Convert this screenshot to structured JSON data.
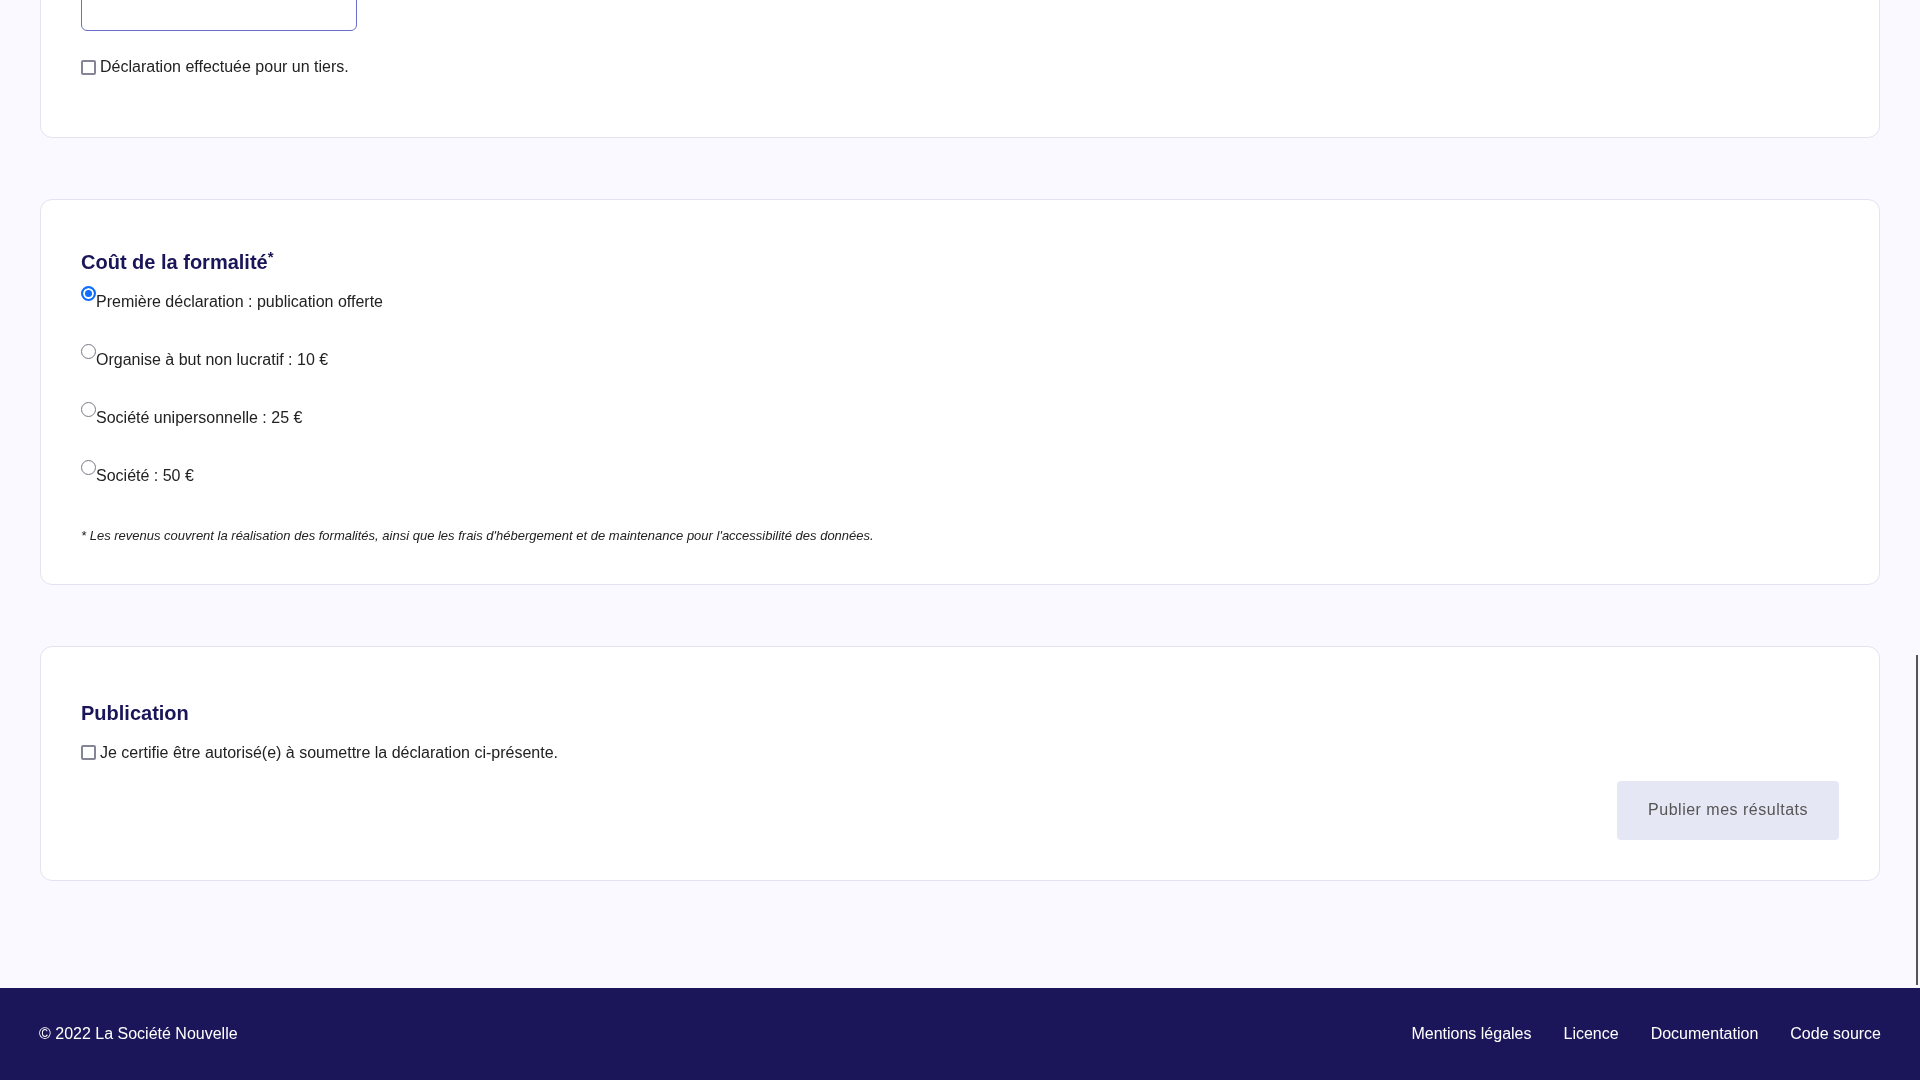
{
  "third_party": {
    "label": "Déclaration effectuée pour un tiers.",
    "checked": false
  },
  "cost": {
    "title": "Coût de la formalité",
    "title_mark": "*",
    "options": [
      {
        "label": "Première déclaration : publication offerte",
        "selected": true
      },
      {
        "label": "Organise à but non lucratif : 10 €",
        "selected": false
      },
      {
        "label": "Société unipersonnelle : 25 €",
        "selected": false
      },
      {
        "label": "Société : 50 €",
        "selected": false
      }
    ],
    "note": "* Les revenus couvrent la réalisation des formalités, ainsi que les frais d'hébergement et de maintenance pour l'accessibilité des données."
  },
  "publication": {
    "title": "Publication",
    "certify": {
      "label": "Je certifie être autorisé(e) à soumettre la déclaration ci-présente.",
      "checked": false
    },
    "button": {
      "label": "Publier mes résultats",
      "disabled": true
    }
  },
  "footer": {
    "copyright": "© 2022 La Société Nouvelle",
    "links": [
      "Mentions légales",
      "Licence",
      "Documentation",
      "Code source"
    ]
  }
}
